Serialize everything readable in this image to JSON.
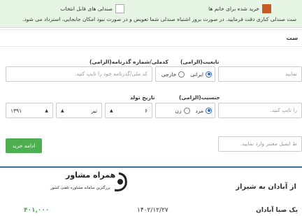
{
  "legend": {
    "female_booked": "خرید شده برای خانم ها",
    "selectable": "صندلی های قابل انتخاب",
    "note": "ست صندلی کناری دقت فرمایید. در صورت بروز اشتباه صندلی شما تعویض و در صورت نبود امکان جابجایی، استرداد می شود.",
    "female_color": "#c95a25"
  },
  "form": {
    "panel_title": "ست",
    "first_input_placeholder": "نمایید",
    "nationality": {
      "label": "تابعیت(الزامی)",
      "options": [
        "ایرانی",
        "خارجی"
      ],
      "selected": "ایرانی"
    },
    "national_code": {
      "label": "کدملی/شماره گذرنامه(الزامی)",
      "placeholder": "کد ملی/گذرنامه خود را تایپ کنید."
    },
    "gender": {
      "label": "جنسیت(الزامی)",
      "options": [
        "مرد",
        "زن"
      ],
      "selected": "مرد"
    },
    "name_placeholder": "را تایپ کنید.",
    "birth_date": {
      "label": "تاریخ تولد",
      "year": "۱۳۹۱",
      "month": "تیر",
      "day": "۶"
    },
    "email_placeholder": "ط ایمیل معتبر وارد نمایید.",
    "continue_button": "ادامه خرید"
  },
  "trip": {
    "route": "از آبادان به شیراز",
    "company": "یک صبا آبادان",
    "date": "۱۴۰۲/۱۲/۲۷",
    "price": "۴۰۱,۰۰۰"
  },
  "watermark": {
    "brand": "همراه مشاور",
    "tagline": "بزرگترین سامانه مشاوره تلفنی کشور"
  }
}
